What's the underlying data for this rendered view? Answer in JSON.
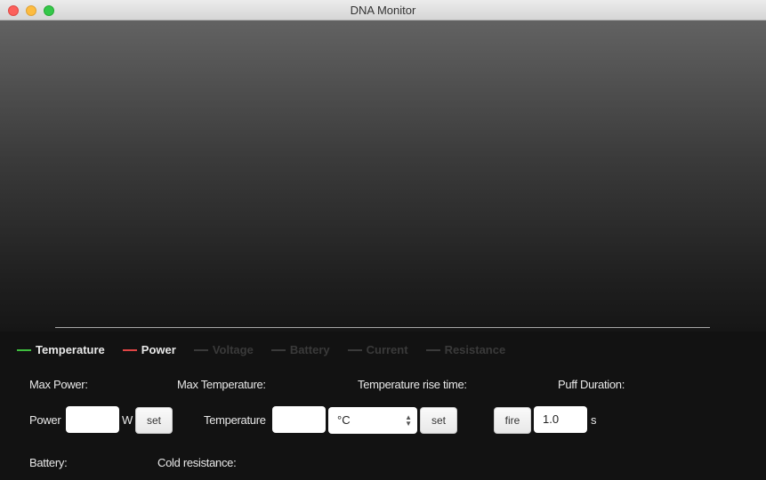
{
  "window": {
    "title": "DNA Monitor"
  },
  "legend": [
    {
      "label": "Temperature",
      "color": "#3fbf3f",
      "active": true
    },
    {
      "label": "Power",
      "color": "#e04545",
      "active": true
    },
    {
      "label": "Voltage",
      "color": "#3a3a3a",
      "active": false
    },
    {
      "label": "Battery",
      "color": "#3a3a3a",
      "active": false
    },
    {
      "label": "Current",
      "color": "#3a3a3a",
      "active": false
    },
    {
      "label": "Resistance",
      "color": "#3a3a3a",
      "active": false
    }
  ],
  "stats": {
    "max_power": "Max Power:",
    "max_temperature": "Max Temperature:",
    "rise_time": "Temperature rise time:",
    "puff_duration": "Puff Duration:",
    "battery": "Battery:",
    "cold_resistance": "Cold resistance:"
  },
  "controls": {
    "power_label": "Power",
    "power_value": "",
    "power_unit": "W",
    "set": "set",
    "temperature_label": "Temperature",
    "temperature_value": "",
    "temp_unit": "°C",
    "fire": "fire",
    "puff_value": "1.0",
    "puff_unit": "s"
  }
}
